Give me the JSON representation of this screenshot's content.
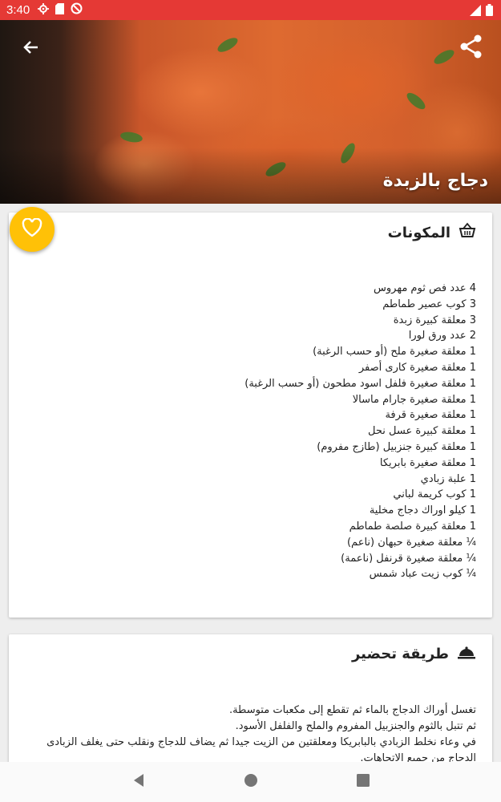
{
  "status_bar": {
    "time": "3:40",
    "icons": [
      "settings-gear-icon",
      "sd-card-icon",
      "blocked-icon",
      "wifi-icon",
      "battery-icon"
    ],
    "color": "#e53935"
  },
  "header": {
    "title": "دجاج بالزبدة",
    "back_icon": "arrow-back-icon",
    "share_icon": "share-icon"
  },
  "favorite": {
    "icon": "heart-outline-icon",
    "color": "#ffc107"
  },
  "ingredients": {
    "icon": "basket-icon",
    "heading": "المكونات",
    "items": [
      "4 عدد فص ثوم مهروس",
      "3 كوب عصير طماطم",
      "3 معلقة كبيرة زبدة",
      "2 عدد ورق لورا",
      "1 معلقة صغيرة ملح (أو حسب الرغبة)",
      "1 معلقة صغيرة كارى أصفر",
      "1 معلقة صغيرة فلفل اسود مطحون (أو حسب الرغبة)",
      "1 معلقة صغيرة جارام ماسالا",
      "1 معلقة صغيرة قرفة",
      "1 معلقة كبيرة عسل نحل",
      "1 معلقة كبيرة جنزبيل (طازج مفروم)",
      "1 معلقة صغيرة بابريكا",
      "1 علبة زبادي",
      "1 كوب كريمة لباني",
      "1 كيلو اوراك دجاج مخلية",
      "1 معلقة كبيرة صلصة طماطم",
      "¼ معلقة صغيرة حبهان (ناعم)",
      "¼ معلقة صغيرة قرنفل (ناعمة)",
      "¼ كوب زيت عباد شمس"
    ]
  },
  "method": {
    "icon": "cloche-icon",
    "heading": "طريقة تحضير",
    "lines": [
      "تغسل أوراك الدجاج بالماء ثم تقطع إلى مكعبات متوسطة.",
      "ثم تتبل بالثوم والجنزبيل المفروم والملح والفلفل الأسود.",
      "في وعاء نخلط الزبادي بالبابريكا ومعلقتين من الزيت جيدا ثم يضاف للدجاج ونقلب حتى يغلف الزبادى الدجاج من جميع الاتجاهات."
    ]
  },
  "nav": {
    "back_icon": "nav-back-triangle-icon",
    "home_icon": "nav-home-circle-icon",
    "recents_icon": "nav-recents-square-icon"
  }
}
